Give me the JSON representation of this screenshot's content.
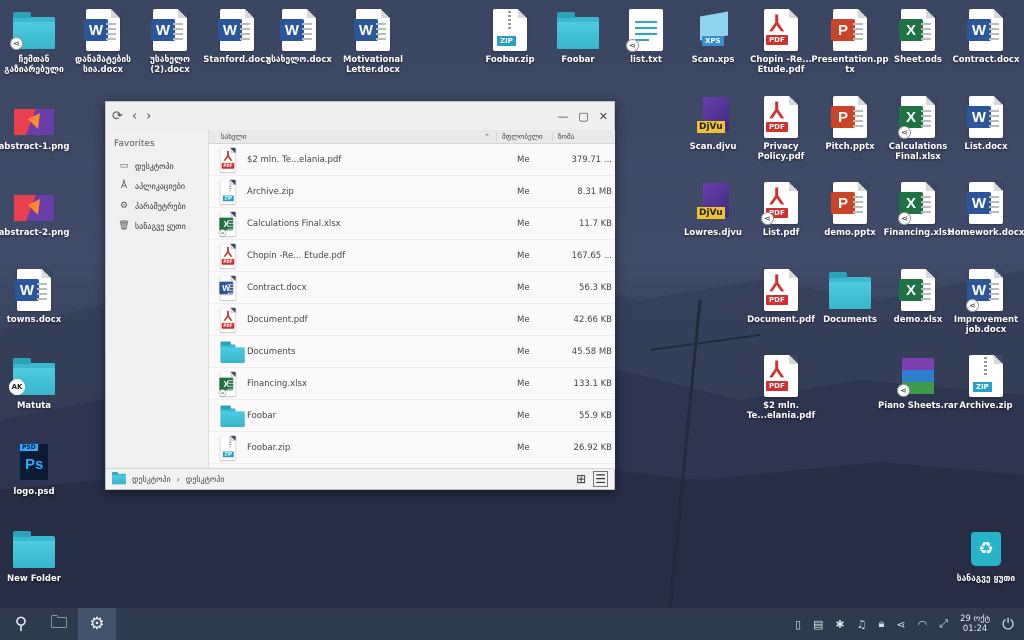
{
  "desktop_icons": [
    {
      "label": "ჩემთან გაზიარებული",
      "type": "folder",
      "share": true
    },
    {
      "label": "დანამატების სია.docx",
      "type": "word"
    },
    {
      "label": "უსახელო (2).docx",
      "type": "word"
    },
    {
      "label": "Stanford.docx",
      "type": "word"
    },
    {
      "label": "უსახელო.docx",
      "type": "word"
    },
    {
      "label": "Motivational Letter.docx",
      "type": "word"
    },
    {
      "label": "Foobar.zip",
      "type": "zip"
    },
    {
      "label": "Foobar",
      "type": "folder"
    },
    {
      "label": "list.txt",
      "type": "txt",
      "share": true
    },
    {
      "label": "Scan.xps",
      "type": "xps"
    },
    {
      "label": "Chopin -Re... Etude.pdf",
      "type": "pdf"
    },
    {
      "label": "Presentation.pptx",
      "type": "ppt"
    },
    {
      "label": "Sheet.ods",
      "type": "excel"
    },
    {
      "label": "Contract.docx",
      "type": "word"
    },
    {
      "label": "abstract-1.png",
      "type": "image"
    },
    {
      "label": "Scan.djvu",
      "type": "djvu"
    },
    {
      "label": "Privacy Policy.pdf",
      "type": "pdf"
    },
    {
      "label": "Pitch.pptx",
      "type": "ppt"
    },
    {
      "label": "Calculations Final.xlsx",
      "type": "excel",
      "share": true
    },
    {
      "label": "List.docx",
      "type": "word"
    },
    {
      "label": "abstract-2.png",
      "type": "image"
    },
    {
      "label": "Lowres.djvu",
      "type": "djvu"
    },
    {
      "label": "List.pdf",
      "type": "pdf",
      "share": true
    },
    {
      "label": "demo.pptx",
      "type": "ppt"
    },
    {
      "label": "Financing.xlsx",
      "type": "excel",
      "share": true
    },
    {
      "label": "Homework.docx",
      "type": "word"
    },
    {
      "label": "towns.docx",
      "type": "word"
    },
    {
      "label": "Document.pdf",
      "type": "pdf"
    },
    {
      "label": "Documents",
      "type": "folder"
    },
    {
      "label": "demo.xlsx",
      "type": "excel"
    },
    {
      "label": "Improvement job.docx",
      "type": "word",
      "share": true
    },
    {
      "label": "Matuta",
      "type": "folder",
      "avatar": "AK"
    },
    {
      "label": "$2 mln. Te...elania.pdf",
      "type": "pdf"
    },
    {
      "label": "Piano Sheets.rar",
      "type": "rar",
      "share": true
    },
    {
      "label": "Archive.zip",
      "type": "zip"
    },
    {
      "label": "logo.psd",
      "type": "psd"
    },
    {
      "label": "New Folder",
      "type": "folder"
    },
    {
      "label": "სანაგვე ყუთი",
      "type": "trash"
    }
  ],
  "colors": {
    "word": "#2b579a",
    "excel": "#1f7244",
    "ppt": "#c9452a",
    "pdf": "#d32f2f",
    "folder": "#3ab8cf",
    "taskbar": "#303a4f"
  },
  "window": {
    "sidebar": {
      "heading": "Favorites",
      "items": [
        {
          "label": "დესკტოპი",
          "icon": "monitor-icon"
        },
        {
          "label": "აპლიკაციები",
          "icon": "apps-icon"
        },
        {
          "label": "პარამეტრები",
          "icon": "gear-icon"
        },
        {
          "label": "სანაგვე ყუთი",
          "icon": "trash-icon"
        }
      ]
    },
    "columns": {
      "name": "სახელი",
      "owner": "მფლობელი",
      "size": "ზომა"
    },
    "files": [
      {
        "name": "$2 mln. Te...elania.pdf",
        "owner": "Me",
        "size": "379.71 ...",
        "type": "pdf"
      },
      {
        "name": "Archive.zip",
        "owner": "Me",
        "size": "8.31 MB",
        "type": "zip"
      },
      {
        "name": "Calculations Final.xlsx",
        "owner": "Me",
        "size": "11.7 KB",
        "type": "excel",
        "share": true
      },
      {
        "name": "Chopin -Re... Etude.pdf",
        "owner": "Me",
        "size": "167.65 ...",
        "type": "pdf"
      },
      {
        "name": "Contract.docx",
        "owner": "Me",
        "size": "56.3 KB",
        "type": "word"
      },
      {
        "name": "Document.pdf",
        "owner": "Me",
        "size": "42.66 KB",
        "type": "pdf"
      },
      {
        "name": "Documents",
        "owner": "Me",
        "size": "45.58 MB",
        "type": "folder"
      },
      {
        "name": "Financing.xlsx",
        "owner": "Me",
        "size": "133.1 KB",
        "type": "excel",
        "share": true
      },
      {
        "name": "Foobar",
        "owner": "Me",
        "size": "55.9 KB",
        "type": "folder"
      },
      {
        "name": "Foobar.zip",
        "owner": "Me",
        "size": "26.92 KB",
        "type": "zip"
      }
    ],
    "breadcrumb": {
      "root": "დესკტოპი",
      "separator": "›",
      "current": "დესკტოპი"
    }
  },
  "taskbar": {
    "clock_date": "29 ოქტ",
    "clock_time": "01:24"
  }
}
